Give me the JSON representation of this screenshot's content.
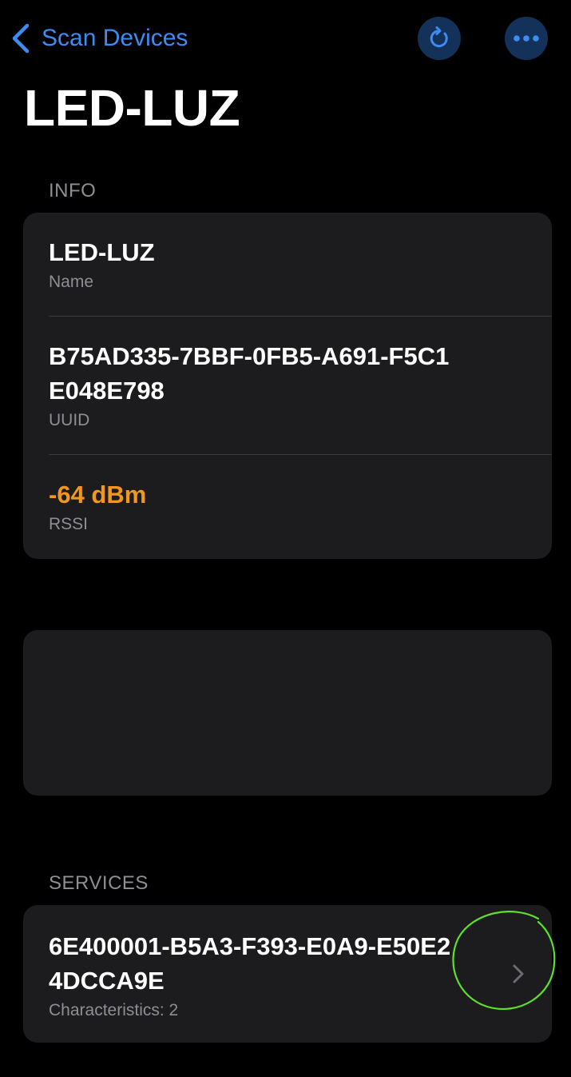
{
  "nav": {
    "back_label": "Scan Devices",
    "accent_color": "#3d8cf2"
  },
  "page": {
    "title": "LED-LUZ"
  },
  "info": {
    "header": "INFO",
    "rows": [
      {
        "value": "LED-LUZ",
        "label": "Name"
      },
      {
        "value": "B75AD335-7BBF-0FB5-A691-F5C1E048E798",
        "label": "UUID"
      },
      {
        "value": "-64 dBm",
        "label": "RSSI",
        "color": "#f2961c"
      }
    ]
  },
  "services": {
    "header": "SERVICES",
    "items": [
      {
        "uuid": "6E400001-B5A3-F393-E0A9-E50E24DCCA9E",
        "characteristics": "Characteristics: 2"
      }
    ]
  },
  "icons": {
    "back": "chevron-left-icon",
    "refresh": "refresh-icon",
    "more": "ellipsis-icon",
    "disclosure": "chevron-right-icon"
  },
  "annotation": {
    "color": "#5de02a"
  }
}
